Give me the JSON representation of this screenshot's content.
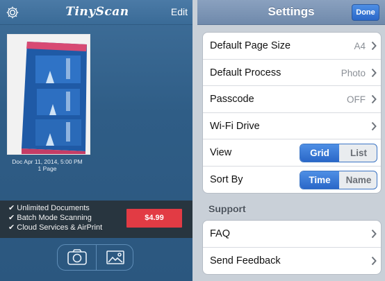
{
  "left": {
    "brand": "TinyScan",
    "edit_label": "Edit",
    "doc": {
      "date": "Doc Apr 11, 2014, 5:00 PM",
      "pages": "1 Page"
    },
    "promo": {
      "features": [
        "✔ Unlimited Documents",
        "✔ Batch Mode Scanning",
        "✔ Cloud Services & AirPrint"
      ],
      "price": "$4.99"
    },
    "icons": {
      "settings": "gear-icon",
      "camera": "camera-icon",
      "gallery": "photo-gallery-icon"
    }
  },
  "right": {
    "nav": {
      "title": "Settings",
      "done": "Done"
    },
    "rows": [
      {
        "label": "Default Page Size",
        "value": "A4"
      },
      {
        "label": "Default Process",
        "value": "Photo"
      },
      {
        "label": "Passcode",
        "value": "OFF"
      },
      {
        "label": "Wi-Fi Drive",
        "value": ""
      }
    ],
    "view": {
      "label": "View",
      "options": [
        "Grid",
        "List"
      ],
      "selected": "Grid"
    },
    "sort": {
      "label": "Sort By",
      "options": [
        "Time",
        "Name"
      ],
      "selected": "Time"
    },
    "support_header": "Support",
    "support_rows": [
      {
        "label": "FAQ"
      },
      {
        "label": "Send Feedback"
      }
    ]
  },
  "colors": {
    "accent": "#3a74c4",
    "buy": "#e23b44",
    "nav": "#6f89ab"
  }
}
